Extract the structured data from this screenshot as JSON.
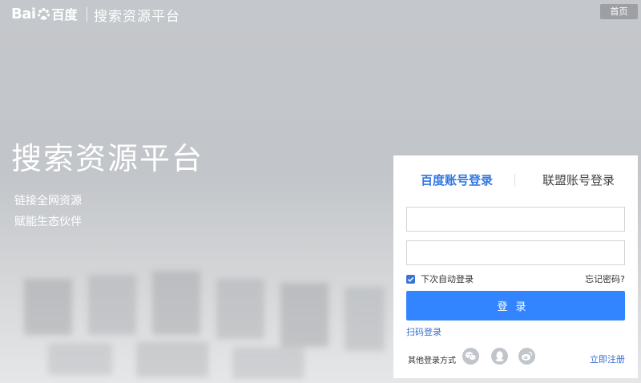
{
  "header": {
    "logo_text": "Bai",
    "logo_text_cn": "百度",
    "platform_name": "搜索资源平台",
    "home_label": "首页"
  },
  "hero": {
    "title": "搜索资源平台",
    "subtitle_line1": "链接全网资源",
    "subtitle_line2": "赋能生态伙伴"
  },
  "login": {
    "tabs": [
      {
        "label": "百度账号登录",
        "active": true
      },
      {
        "label": "联盟账号登录",
        "active": false
      }
    ],
    "username_value": "",
    "password_value": "",
    "remember_label": "下次自动登录",
    "remember_checked": true,
    "forgot_label": "忘记密码?",
    "submit_label": "登录",
    "qr_login_label": "扫码登录",
    "other_methods_label": "其他登录方式",
    "social_icons": [
      "wechat-icon",
      "qq-icon",
      "weibo-icon"
    ],
    "register_label": "立即注册"
  },
  "colors": {
    "accent": "#3385ff",
    "link": "#3a6fd1",
    "active_tab": "#3377e3",
    "home_button_bg": "#9d9fa2"
  }
}
